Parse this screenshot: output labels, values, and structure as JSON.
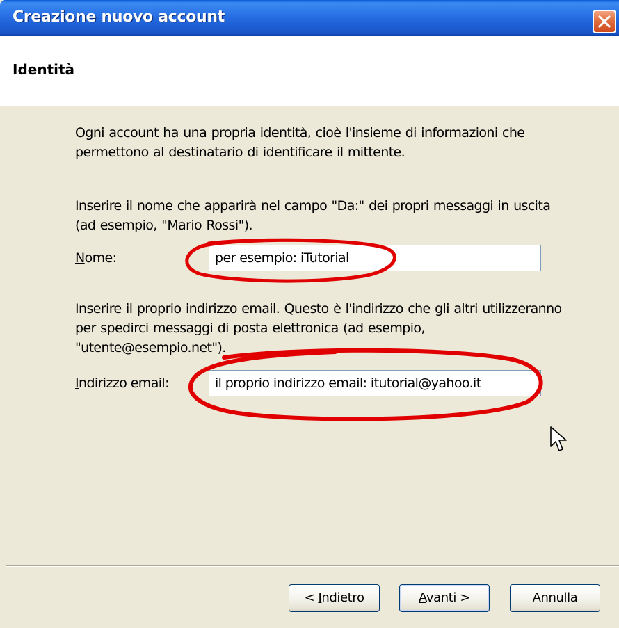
{
  "window": {
    "title": "Creazione nuovo account"
  },
  "header": {
    "title": "Identità"
  },
  "content": {
    "intro_text": "Ogni account ha una propria identità, cioè l'insieme di informazioni che permettono al destinatario di identificare il mittente.",
    "name_description": "Inserire il nome che apparirà nel campo \"Da:\" dei propri messaggi in uscita (ad esempio, \"Mario Rossi\").",
    "name_label_access": "N",
    "name_label_rest": "ome:",
    "name_value": "per esempio: iTutorial",
    "email_description": "Inserire il proprio indirizzo email. Questo è l'indirizzo che gli altri utilizzeranno per spedirci messaggi di posta elettronica (ad esempio, \"utente@esempio.net\").",
    "email_label_access": "I",
    "email_label_rest": "ndirizzo email:",
    "email_value": "il proprio indirizzo email: itutorial@yahoo.it"
  },
  "buttons": {
    "back_prefix": "< ",
    "back_access": "I",
    "back_rest": "ndietro",
    "next_access": "A",
    "next_rest": "vanti >",
    "cancel": "Annulla"
  },
  "colors": {
    "titlebar": "#2a72e6",
    "annotation": "#e00000",
    "dialog_bg": "#ece9d8"
  },
  "icons": [
    "close-icon",
    "mouse-cursor-icon"
  ]
}
